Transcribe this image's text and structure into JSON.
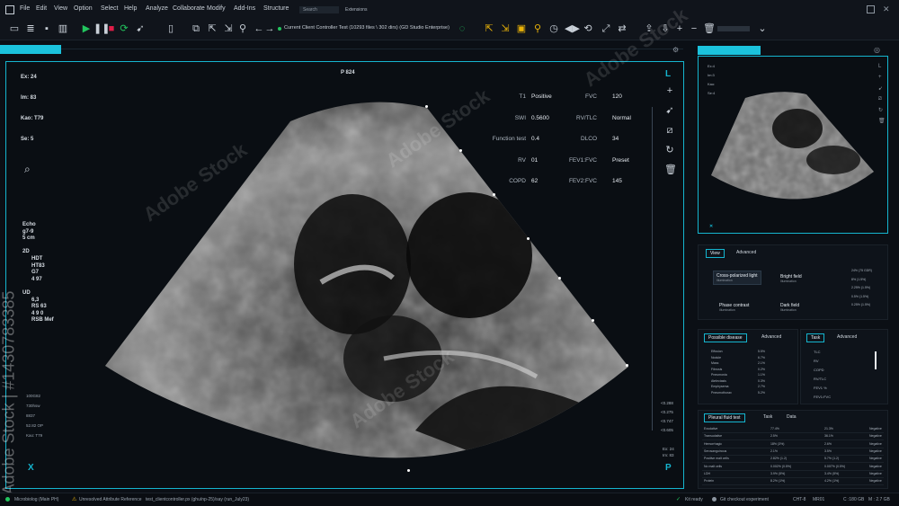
{
  "menu": {
    "items": [
      "File",
      "Edit",
      "View",
      "Option",
      "Select",
      "Help",
      "Analyze",
      "Collaborate",
      "Modify",
      "Add-Ins",
      "Structure"
    ],
    "search_placeholder": "Search",
    "extensions": "Extensions"
  },
  "toolbar": {
    "controller_text": "Current Client Controller Test (10293 files \\ 302 dirs) (GD Studio Enterprise)"
  },
  "main": {
    "frame_number": "P 824",
    "left_info": [
      {
        "text": "Ex: 24"
      },
      {
        "text": "Im: 83"
      },
      {
        "text": "Kao: T79"
      },
      {
        "text": "Se: 5"
      }
    ],
    "scan_params": [
      "Echo",
      "g7-9",
      "5 cm",
      "",
      "2D",
      "HDT",
      "HT83",
      "G7",
      "4 97",
      "",
      "UD",
      "6,3",
      "RS 63",
      "4 9 0",
      "RSB Mef"
    ],
    "lower_left": [
      "100G82",
      "730hsw",
      "8837",
      "52.82 OP",
      "Kao: T79"
    ],
    "corner_left": "X",
    "corner_right_top": "L",
    "corner_right_bottom": "P",
    "scale_labels": [
      "<0.288",
      "<0.275",
      "<0.747",
      "<0.605"
    ],
    "lower_right_labels": [
      "Ex: 24",
      "Im: 83"
    ],
    "table": [
      {
        "l1": "T1",
        "v1": "Positive",
        "l2": "FVC",
        "v2": "120"
      },
      {
        "l1": "SWI",
        "v1": "0.5600",
        "l2": "RV/TLC",
        "v2": "Normal"
      },
      {
        "l1": "Function test",
        "v1": "0.4",
        "l2": "DLCO",
        "v2": "34"
      },
      {
        "l1": "RV",
        "v1": "01",
        "l2": "FEV1:FVC",
        "v2": "Preset"
      },
      {
        "l1": "COPD",
        "v1": "62",
        "l2": "FEV2:FVC",
        "v2": "145"
      }
    ]
  },
  "right": {
    "preview_labels": [
      "Ex:4",
      "Im:3",
      "Kao:",
      "Se:4"
    ],
    "view_tabs": [
      "View",
      "Advanced"
    ],
    "illum_options": [
      {
        "name": "Cross-polarized light",
        "sub": "Illumination"
      },
      {
        "name": "Bright field",
        "sub": "Illumination"
      },
      {
        "name": "Phase contrast",
        "sub": "Illumination"
      },
      {
        "name": "Dark field",
        "sub": "Illumination"
      }
    ],
    "illum_values": [
      "24% (75 GDR)",
      "8% (1.5%)",
      "2.25% (1.5%)",
      "0.5% (1.5%)",
      "0.25% (1.5%)"
    ],
    "disease_tabs": [
      "Possible disease",
      "Advanced"
    ],
    "diseases": [
      {
        "name": "Effusion",
        "value": "5.5%"
      },
      {
        "name": "Nodule",
        "value": "6.7%"
      },
      {
        "name": "Mass",
        "value": "2.1%"
      },
      {
        "name": "Fibrosis",
        "value": "0.2%"
      },
      {
        "name": "Pneumonia",
        "value": "1.1%"
      },
      {
        "name": "Atelectasis",
        "value": "0.3%"
      },
      {
        "name": "Emphysema",
        "value": "2.7%"
      },
      {
        "name": "Pneumothorax",
        "value": "5.2%"
      }
    ],
    "task_tabs": [
      "Task",
      "Advanced"
    ],
    "tasks": [
      "TLC",
      "RV",
      "COPD",
      "RV/TLC",
      "FEV1 %",
      "FEV1:FVC"
    ],
    "fluid_tabs": [
      "Pleural fluid test",
      "Task",
      "Data"
    ],
    "fluid_rows": [
      {
        "name": "Exudative",
        "a": "77.4%",
        "b": "21.3%",
        "c": "Negative"
      },
      {
        "name": "Transudative",
        "a": "2.5%",
        "b": "36.1%",
        "c": "Negative"
      },
      {
        "name": "Hemorrhagic",
        "a": "18% (3%)",
        "b": "2.6%",
        "c": "Negative"
      },
      {
        "name": "Serosanguinous",
        "a": "2.1%",
        "b": "3.5%",
        "c": "Negative"
      },
      {
        "name": "Positive malt cells",
        "a": "2.82% (1.2)",
        "b": "5.7% (1.2)",
        "c": "Negative"
      },
      {
        "name": "No malt cells",
        "a": "0.002% (0.5%)",
        "b": "0.007% (0.5%)",
        "c": "Negative"
      },
      {
        "name": "LDH",
        "a": "3.9% (5%)",
        "b": "3.4% (5%)",
        "c": "Negative"
      },
      {
        "name": "Protein",
        "a": "8.2% (1%)",
        "b": "4.2% (1%)",
        "c": "Negative"
      }
    ]
  },
  "status": {
    "left": "Microbiolog (Main PH)",
    "warning": "Unresolved Attribute Reference",
    "path": "test_clientcontroller.px (ghu/np-25)/say (run_July23)",
    "ready": "Kit ready",
    "git": "Git checkout experiment",
    "mode": "CHT-8",
    "mode2": "MR01",
    "mem": "C :180 GB",
    "mem2": "M : 2.7 GB"
  },
  "watermark": {
    "text": "Adobe Stock",
    "id": "Adobe Stock | #1430783385"
  },
  "colors": {
    "accent": "#15b5cf",
    "background": "#0b0f15"
  }
}
